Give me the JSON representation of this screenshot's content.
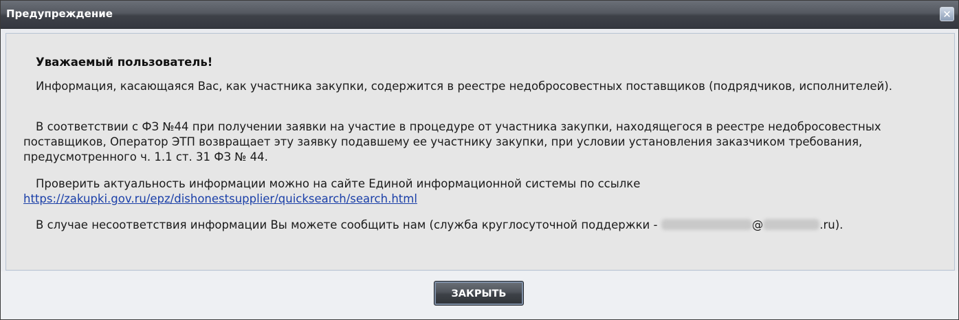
{
  "window": {
    "title": "Предупреждение",
    "close_icon": "close-icon",
    "close_glyph": "✕"
  },
  "message": {
    "heading": "Уважаемый пользователь!",
    "paragraph_1": "Информация, касающаяся Вас, как участника закупки, содержится в реестре недобросовестных поставщиков (подрядчиков, исполнителей).",
    "paragraph_2": "В соответствии с ФЗ №44 при получении заявки на участие в процедуре от участника закупки, находящегося в реестре недобросовестных поставщиков, Оператор ЭТП возвращает эту заявку подавшему ее участнику закупки, при условии установления заказчиком требования, предусмотренного ч. 1.1 ст. 31 ФЗ № 44.",
    "paragraph_3_text": "Проверить актуальность информации можно на сайте Единой информационной системы по ссылке",
    "paragraph_3_link": "https://zakupki.gov.ru/epz/dishonestsupplier/quicksearch/search.html",
    "paragraph_4_prefix": "В случае несоответствия информации Вы можете сообщить нам (служба круглосуточной поддержки -",
    "paragraph_4_at": "@",
    "paragraph_4_suffix": ".ru)."
  },
  "footer": {
    "close_button_label": "ЗАКРЫТЬ"
  }
}
